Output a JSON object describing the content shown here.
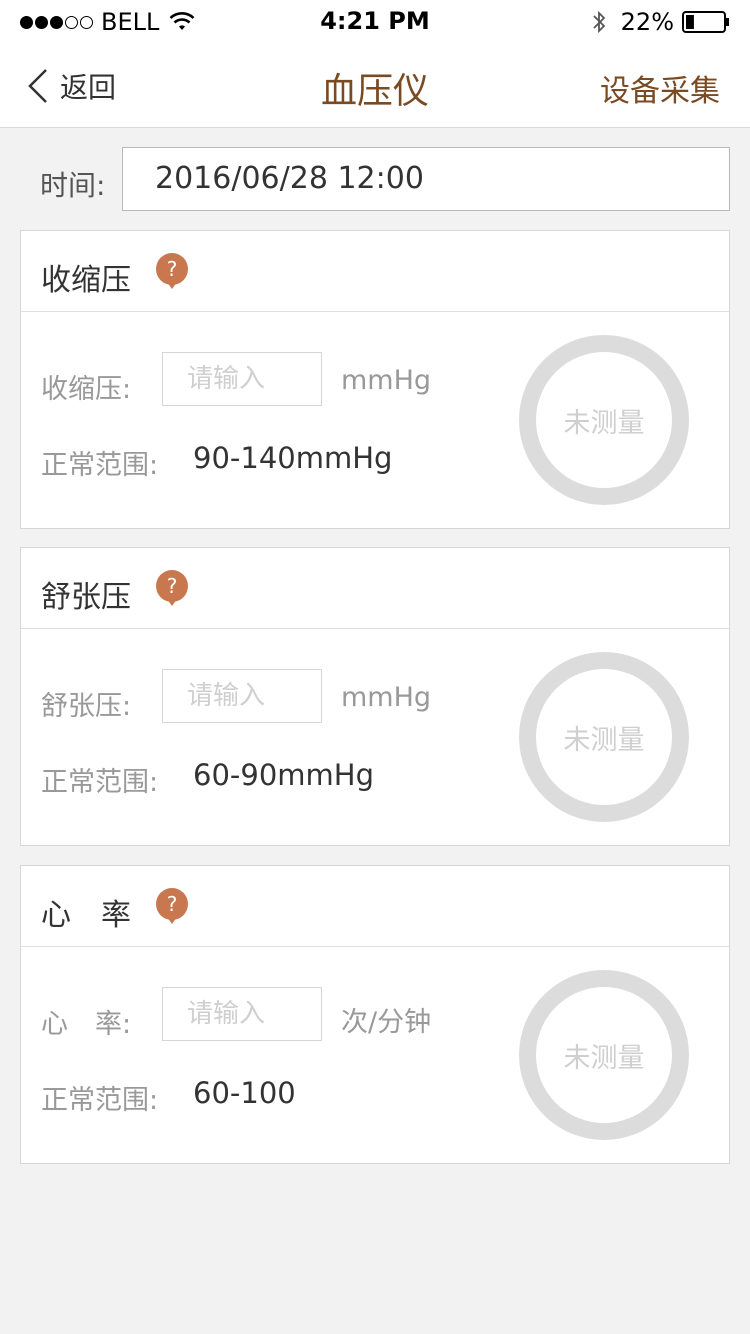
{
  "status_bar": {
    "carrier": "BELL",
    "time": "4:21 PM",
    "battery": "22%",
    "battery_level": 0.22,
    "signal_dots": 5,
    "signal_filled": 3,
    "icons": [
      "wifi-icon",
      "bluetooth-icon",
      "battery-icon"
    ]
  },
  "nav": {
    "back_label": "返回",
    "title": "血压仪",
    "right_action": "设备采集"
  },
  "time_field": {
    "label": "时间:",
    "value": "2016/06/28 12:00"
  },
  "cards": [
    {
      "title": "收缩压",
      "field_label": "收缩压:",
      "placeholder": "请输入",
      "unit": "mmHg",
      "range_label": "正常范围:",
      "range_value": "90-140mmHg",
      "status": "未测量"
    },
    {
      "title": "舒张压",
      "field_label": "舒张压:",
      "placeholder": "请输入",
      "unit": "mmHg",
      "range_label": "正常范围:",
      "range_value": "60-90mmHg",
      "status": "未测量"
    },
    {
      "title": "心　率",
      "field_label": "心　率:",
      "placeholder": "请输入",
      "unit": "次/分钟",
      "range_label": "正常范围:",
      "range_value": "60-100",
      "status": "未测量"
    }
  ],
  "colors": {
    "accent_brown": "#7a4a22",
    "help_badge": "#c8774f",
    "ring_gray": "#dcdcdc",
    "background": "#f2f2f2"
  }
}
